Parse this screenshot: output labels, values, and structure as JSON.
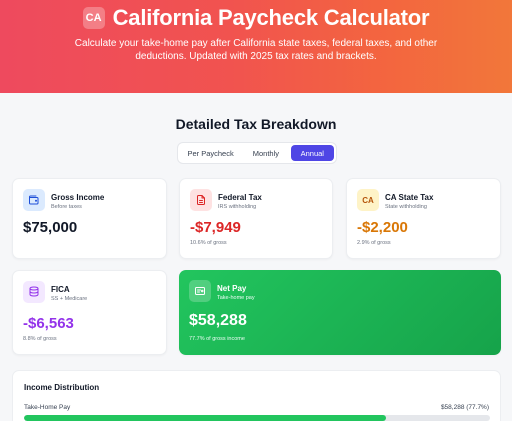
{
  "header": {
    "badge": "CA",
    "title": "California Paycheck Calculator",
    "subtitle": "Calculate your take-home pay after California state taxes, federal taxes, and other deductions. Updated with 2025 tax rates and brackets."
  },
  "breakdown": {
    "title": "Detailed Tax Breakdown",
    "periods": [
      "Per Paycheck",
      "Monthly",
      "Annual"
    ],
    "selected_period": "Annual"
  },
  "cards": {
    "gross": {
      "label": "Gross Income",
      "sub": "Before taxes",
      "value": "$75,000",
      "icon": "wallet-icon"
    },
    "federal": {
      "label": "Federal Tax",
      "sub": "IRS withholding",
      "value": "-$7,949",
      "note": "10.6% of gross",
      "icon": "document-icon",
      "color": "#dc2626"
    },
    "state": {
      "label": "CA State Tax",
      "sub": "State withholding",
      "value": "-$2,200",
      "note": "2.9% of gross",
      "badge": "CA",
      "color": "#d97706"
    },
    "fica": {
      "label": "FICA",
      "sub": "SS + Medicare",
      "value": "-$6,563",
      "note": "8.8% of gross",
      "icon": "database-icon",
      "color": "#9333ea"
    },
    "net": {
      "label": "Net Pay",
      "sub": "Take-home pay",
      "value": "$58,288",
      "note": "77.7% of gross income",
      "icon": "receipt-icon"
    }
  },
  "distribution": {
    "title": "Income Distribution",
    "rows": [
      {
        "label": "Take-Home Pay",
        "value": "$58,288 (77.7%)",
        "percent": 77.7,
        "color": "#22c55e"
      }
    ]
  }
}
